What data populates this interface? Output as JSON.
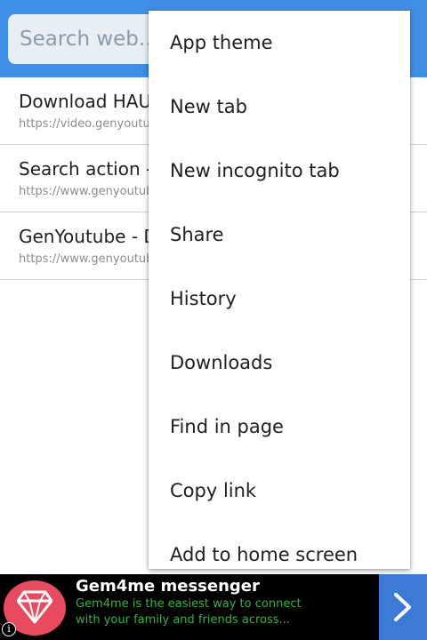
{
  "search": {
    "placeholder": "Search web..."
  },
  "results": [
    {
      "title": "Download HAUTE COUTURE SHOW",
      "url": "https://video.genyoutube.net/"
    },
    {
      "title": "Search action - GenYoutube",
      "url": "https://www.genyoutube.net/"
    },
    {
      "title": "GenYoutube - Download",
      "url": "https://www.genyoutube.net/"
    }
  ],
  "menu": {
    "items": [
      "App theme",
      "New tab",
      "New incognito tab",
      "Share",
      "History",
      "Downloads",
      "Find in page",
      "Copy link",
      "Add to home screen"
    ]
  },
  "ad": {
    "title": "Gem4me messenger",
    "line1": "Gem4me is the easiest way to connect",
    "line2": "with your family and friends across...",
    "info_glyph": "i",
    "logo_icon": "gem-icon",
    "arrow_icon": "chevron-right-icon"
  },
  "colors": {
    "toolbar": "#3f8fe6",
    "ad_text_green": "#3cb043",
    "ad_logo": "#e84a5f",
    "ad_button": "#3d7ad6"
  }
}
